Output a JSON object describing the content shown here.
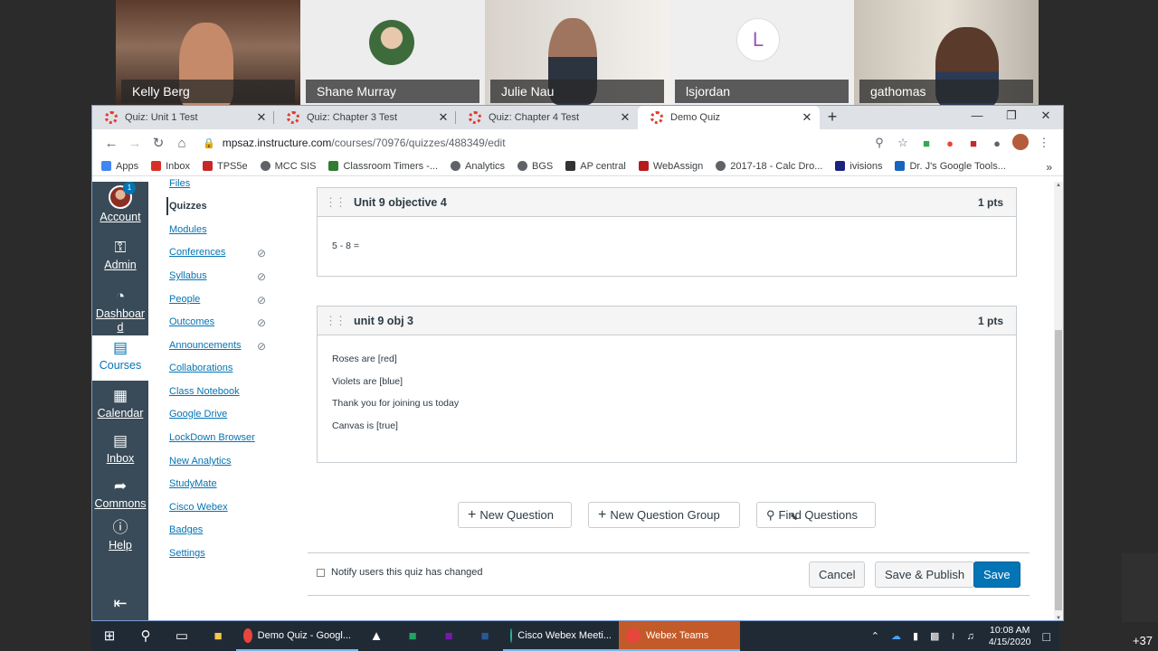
{
  "participants": [
    {
      "name": "Kelly Berg"
    },
    {
      "name": "Shane Murray"
    },
    {
      "name": "Julie Nau"
    },
    {
      "name": "lsjordan",
      "initial": "L"
    },
    {
      "name": "gathomas"
    }
  ],
  "extra_participants": "+37",
  "browser": {
    "tabs": [
      {
        "title": "Quiz: Unit 1 Test",
        "close": "✕"
      },
      {
        "title": "Quiz: Chapter 3 Test",
        "close": "✕"
      },
      {
        "title": "Quiz: Chapter 4 Test",
        "close": "✕"
      },
      {
        "title": "Demo Quiz",
        "close": "✕"
      }
    ],
    "new_tab": "+",
    "url_domain": "mpsaz.instructure.com",
    "url_path": "/courses/70976/quizzes/488349/edit",
    "bookmarks": [
      {
        "label": "Apps",
        "color": "#4285f4"
      },
      {
        "label": "Inbox",
        "color": "#d93025"
      },
      {
        "label": "TPS5e",
        "color": "#c62828"
      },
      {
        "label": "MCC SIS",
        "color": "#5f6368"
      },
      {
        "label": "Classroom Timers -...",
        "color": "#2e7d32"
      },
      {
        "label": "Analytics",
        "color": "#5f6368"
      },
      {
        "label": "BGS",
        "color": "#5f6368"
      },
      {
        "label": "AP central",
        "color": "#333333"
      },
      {
        "label": "WebAssign",
        "color": "#b71c1c"
      },
      {
        "label": "2017-18 - Calc Dro...",
        "color": "#5f6368"
      },
      {
        "label": "ivisions",
        "color": "#1a237e"
      },
      {
        "label": "Dr. J's Google Tools...",
        "color": "#1565c0"
      }
    ],
    "bookmarks_more": "»"
  },
  "global_nav": {
    "account_badge": "1",
    "items": [
      {
        "label": "Account"
      },
      {
        "label": "Admin"
      },
      {
        "label": "Dashboard"
      },
      {
        "label": "Courses"
      },
      {
        "label": "Calendar"
      },
      {
        "label": "Inbox"
      },
      {
        "label": "Commons"
      },
      {
        "label": "Help"
      }
    ]
  },
  "course_nav": [
    {
      "label": "Files",
      "hidden": false
    },
    {
      "label": "Quizzes",
      "hidden": false,
      "active": true
    },
    {
      "label": "Modules",
      "hidden": false
    },
    {
      "label": "Conferences",
      "hidden": true
    },
    {
      "label": "Syllabus",
      "hidden": true
    },
    {
      "label": "People",
      "hidden": true
    },
    {
      "label": "Outcomes",
      "hidden": true
    },
    {
      "label": "Announcements",
      "hidden": true
    },
    {
      "label": "Collaborations",
      "hidden": false
    },
    {
      "label": "Class Notebook",
      "hidden": false
    },
    {
      "label": "Google Drive",
      "hidden": false
    },
    {
      "label": "LockDown Browser",
      "hidden": false
    },
    {
      "label": "New Analytics",
      "hidden": false
    },
    {
      "label": "StudyMate",
      "hidden": false
    },
    {
      "label": "Cisco Webex",
      "hidden": false
    },
    {
      "label": "Badges",
      "hidden": false
    },
    {
      "label": "Settings",
      "hidden": false
    }
  ],
  "questions": [
    {
      "title": "Unit 9 objective 4",
      "points": "1 pts",
      "lines": [
        "5 - 8 ="
      ]
    },
    {
      "title": "unit 9 obj 3",
      "points": "1 pts",
      "lines": [
        "Roses are [red]",
        "Violets are [blue]",
        "Thank you for joining us today",
        "Canvas is [true]"
      ]
    }
  ],
  "question_buttons": {
    "new_question": "New Question",
    "new_group": "New Question Group",
    "find": "Find Questions"
  },
  "footer": {
    "notify_label": "Notify users this quiz has changed",
    "notify_checked": false,
    "cancel": "Cancel",
    "save_publish": "Save & Publish",
    "save": "Save"
  },
  "taskbar": {
    "apps": [
      {
        "label": "Demo Quiz - Googl...",
        "color": "#e8453c"
      },
      {
        "label": "Cisco Webex Meeti...",
        "color": "#2bb3a0"
      },
      {
        "label": "Webex Teams",
        "color": "#e8453c"
      }
    ],
    "time": "10:08 AM",
    "date": "4/15/2020"
  },
  "colors": {
    "canvas_nav": "#394b58",
    "link": "#0374b5",
    "primary_button": "#0374b5"
  }
}
